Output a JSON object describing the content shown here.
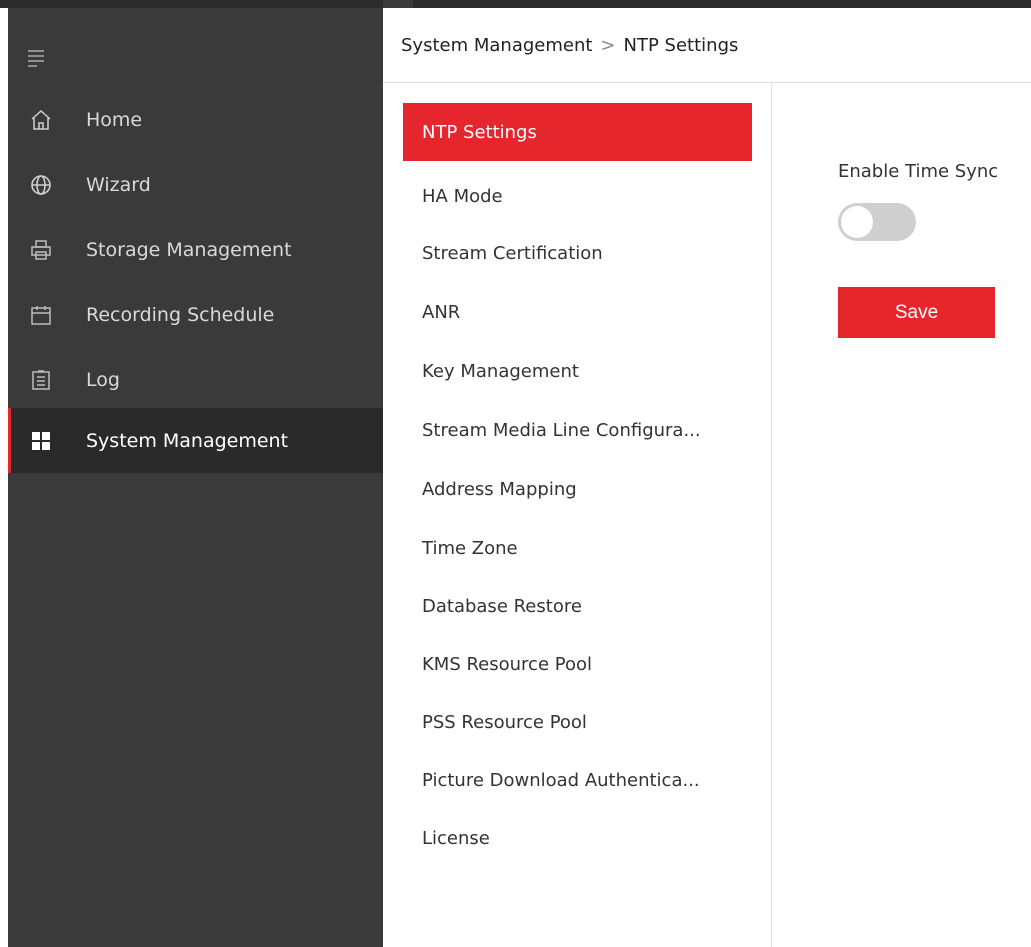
{
  "colors": {
    "accent": "#e6262d",
    "sidebar_bg": "#3a3a3a",
    "sidebar_active_bg": "#2a2a2a"
  },
  "sidebar": {
    "menu_icon": "hamburger-icon",
    "items": [
      {
        "label": "Home",
        "icon": "home-icon"
      },
      {
        "label": "Wizard",
        "icon": "globe-icon"
      },
      {
        "label": "Storage Management",
        "icon": "printer-icon"
      },
      {
        "label": "Recording Schedule",
        "icon": "calendar-icon"
      },
      {
        "label": "Log",
        "icon": "clipboard-icon"
      },
      {
        "label": "System Management",
        "icon": "grid-icon",
        "active": true
      }
    ]
  },
  "breadcrumb": {
    "parent": "System Management",
    "separator": ">",
    "current": "NTP Settings"
  },
  "submenu": {
    "items": [
      {
        "label": "NTP Settings",
        "active": true
      },
      {
        "label": "HA Mode"
      },
      {
        "label": "Stream Certification"
      },
      {
        "label": "ANR"
      },
      {
        "label": "Key Management"
      },
      {
        "label": "Stream Media Line Configura..."
      },
      {
        "label": "Address Mapping"
      },
      {
        "label": "Time Zone"
      },
      {
        "label": "Database Restore"
      },
      {
        "label": "KMS Resource Pool"
      },
      {
        "label": "PSS Resource Pool"
      },
      {
        "label": "Picture Download Authentica..."
      },
      {
        "label": "License"
      }
    ]
  },
  "content": {
    "enable_time_sync_label": "Enable Time Sync",
    "enable_time_sync_on": false,
    "save_label": "Save"
  }
}
